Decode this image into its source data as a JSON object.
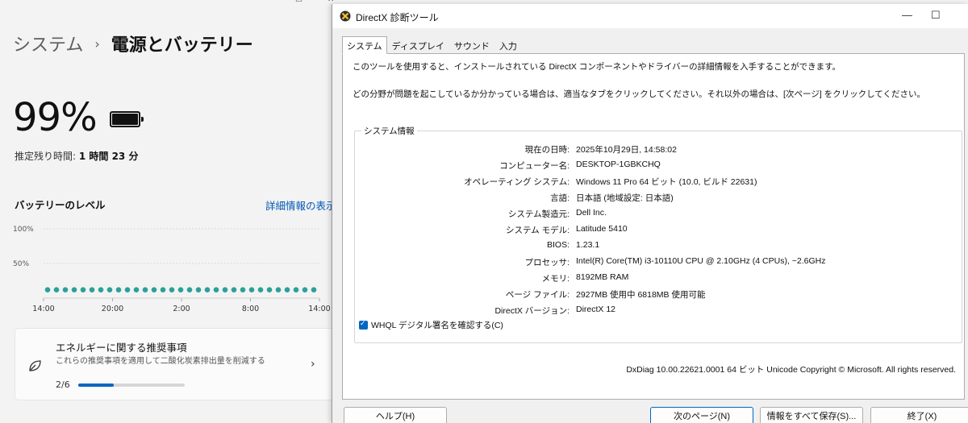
{
  "settings": {
    "breadcrumb_parent": "システム",
    "breadcrumb_chevron": "›",
    "breadcrumb_current": "電源とバッテリー",
    "battery_percent_text": "99%",
    "battery_level": 0.99,
    "remaining_label": "推定残り時間:",
    "remaining_value": "1 時間 23 分",
    "level_title": "バッテリーのレベル",
    "detail_link": "詳細情報の表示",
    "chart_data": {
      "type": "scatter",
      "y_ticks": [
        "100%",
        "50%"
      ],
      "x_ticks": [
        "14:00",
        "20:00",
        "2:00",
        "8:00",
        "14:00"
      ],
      "ylim": [
        0,
        100
      ],
      "grid": true,
      "dot_color": "#2aa198",
      "series": [
        {
          "values": [
            12,
            12,
            12,
            12,
            12,
            12,
            12,
            12,
            12,
            12,
            12,
            12,
            12,
            12,
            12,
            12,
            12,
            12,
            12,
            12,
            12,
            12,
            12,
            12,
            12,
            12,
            12,
            12,
            12,
            12,
            12
          ]
        }
      ]
    },
    "reco": {
      "title": "エネルギーに関する推奨事項",
      "subtitle": "これらの推奨事項を適用して二酸化炭素排出量を削減する",
      "progress_label": "2/6",
      "progress_fraction": 0.3333,
      "arrow": "›",
      "icon": "leaf-icon"
    }
  },
  "dxdiag": {
    "title": "DirectX 診断ツール",
    "window_buttons": [
      "—",
      "☐"
    ],
    "tabs": [
      "システム",
      "ディスプレイ",
      "サウンド",
      "入力"
    ],
    "intro_1": "このツールを使用すると、インストールされている DirectX コンポーネントやドライバーの詳細情報を入手することができます。",
    "intro_2": "どの分野が問題を起こしているか分かっている場合は、適当なタブをクリックしてください。それ以外の場合は、[次ページ] をクリックしてください。",
    "group_title": "システム情報",
    "rows": [
      {
        "label": "現在の日時:",
        "value": "2025年10月29日, 14:58:02"
      },
      {
        "label": "コンピューター名:",
        "value": "DESKTOP-1GBKCHQ"
      },
      {
        "label": "オペレーティング システム:",
        "value": "Windows 11 Pro 64 ビット (10.0, ビルド 22631)"
      },
      {
        "label": "言語:",
        "value": "日本語 (地域設定: 日本語)"
      },
      {
        "label": "システム製造元:",
        "value": "Dell Inc."
      },
      {
        "label": "システム モデル:",
        "value": "Latitude 5410"
      },
      {
        "label": "BIOS:",
        "value": "1.23.1"
      },
      {
        "label": "プロセッサ:",
        "value": "Intel(R) Core(TM) i3-10110U CPU @ 2.10GHz (4 CPUs), ~2.6GHz"
      },
      {
        "label": "メモリ:",
        "value": "8192MB RAM"
      },
      {
        "label": "ページ ファイル:",
        "value": "2927MB 使用中 6818MB 使用可能"
      },
      {
        "label": "DirectX バージョン:",
        "value": "DirectX 12"
      }
    ],
    "whql_checkbox": "WHQL デジタル署名を確認する(C)",
    "whql_checked": true,
    "footer": "DxDiag 10.00.22621.0001 64 ビット Unicode  Copyright © Microsoft. All rights reserved.",
    "buttons": {
      "help": "ヘルプ(H)",
      "next": "次のページ(N)",
      "save_all": "情報をすべて保存(S)...",
      "exit": "終了(X)"
    }
  }
}
